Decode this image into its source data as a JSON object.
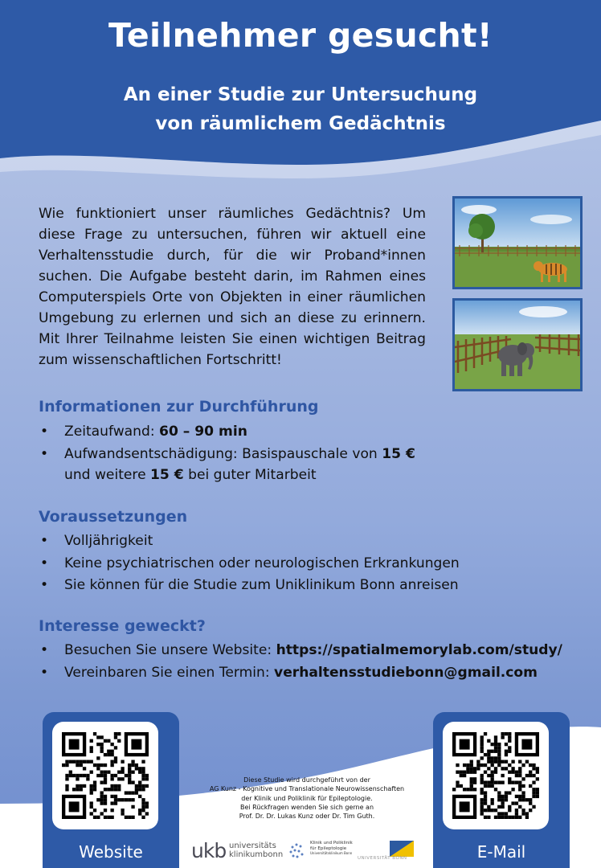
{
  "header": {
    "title": "Teilnehmer gesucht!",
    "subtitle_line1": "An einer Studie zur Untersuchung",
    "subtitle_line2": "von räumlichem Gedächtnis"
  },
  "intro": "Wie funktioniert unser räumliches Gedächtnis? Um diese Frage zu untersuchen, führen wir aktuell eine Verhaltensstudie durch, für die wir Proband*innen suchen. Die Aufgabe besteht darin, im Rahmen eines Computerspiels Orte von Objekten in einer räumlichen Umgebung zu erlernen und sich an diese zu erinnern. Mit Ihrer Teilnahme leisten Sie einen wichtigen Beitrag zum wissenschaftlichen Fortschritt!",
  "sections": {
    "info": {
      "heading": "Informationen zur Durchführung",
      "time_prefix": "Zeitaufwand: ",
      "time_value": "60 – 90 min",
      "comp_prefix": "Aufwandsentschädigung: Basispauschale von ",
      "comp_base": "15 €",
      "comp_mid": "und weitere ",
      "comp_bonus": "15 €",
      "comp_suffix": " bei guter Mitarbeit"
    },
    "requirements": {
      "heading": "Voraussetzungen",
      "items": [
        "Volljährigkeit",
        "Keine psychiatrischen oder neurologischen Erkrankungen",
        "Sie können für die Studie zum Uniklinikum Bonn anreisen"
      ]
    },
    "interest": {
      "heading": "Interesse geweckt?",
      "website_prefix": "Besuchen Sie unsere Website: ",
      "website_url": "https://spatialmemorylab.com/study/",
      "email_prefix": "Vereinbaren Sie einen Termin: ",
      "email_address": "verhaltensstudiebonn@gmail.com"
    }
  },
  "bullet": "•",
  "qr": {
    "website_label": "Website",
    "email_label": "E-Mail"
  },
  "credits": [
    "Diese Studie wird durchgeführt von der",
    "AG Kunz - Kognitive und Translationale Neurowissenschaften",
    "der Klinik und Poliklinik für Epileptologie.",
    "Bei Rückfragen wenden Sie sich gerne an",
    "Prof. Dr. Dr. Lukas Kunz oder Dr. Tim Guth."
  ],
  "logos": {
    "ukb_mark": "ukb",
    "ukb_line1": "universitäts",
    "ukb_line2": "klinikumbonn",
    "klinik_line1": "Klinik und Poliklinik",
    "klinik_line2": "für Epileptologie",
    "klinik_line3": "Universitätsklinikum Bonn",
    "uni_text": "UNIVERSITÄT BONN"
  },
  "colors": {
    "header_blue": "#2e5aa7",
    "heading_blue": "#2f56a3",
    "text": "#111111"
  }
}
